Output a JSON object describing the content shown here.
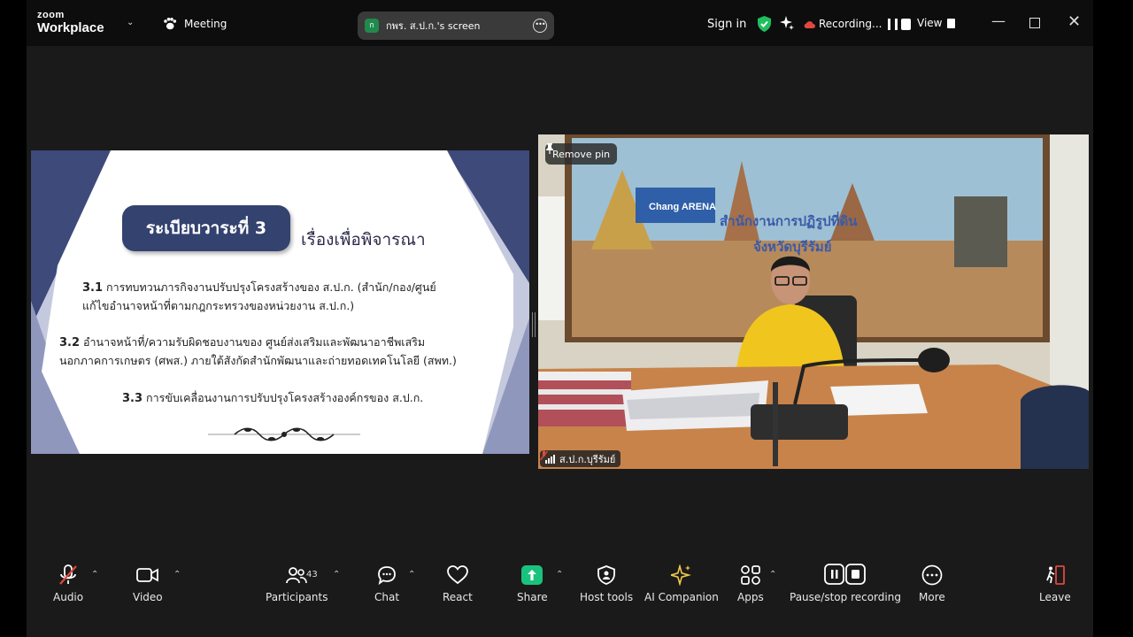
{
  "app": {
    "logo_top": "zoom",
    "logo_bottom": "Workplace",
    "meeting_label": "Meeting",
    "screen_pill": {
      "avatar_letter": "ก",
      "text": "กพร. ส.ป.ก.'s screen"
    },
    "sign_in": "Sign in",
    "recording_label": "Recording...",
    "view_label": "View"
  },
  "colors": {
    "share_green": "#19c37d",
    "shield_green": "#1fbf5f",
    "muted_red": "#e0483e",
    "slide_navy": "#34426f"
  },
  "slide": {
    "agenda_label": "ระเบียบวาระที่ 3",
    "agenda_title": "เรื่องเพื่อพิจารณา",
    "items": [
      {
        "num": "3.1",
        "line1": "การทบทวนภารกิจงานปรับปรุงโครงสร้างของ ส.ป.ก. (สำนัก/กอง/ศูนย์",
        "line2": "แก้ไขอำนาจหน้าที่ตามกฎกระทรวงของหน่วยงาน ส.ป.ก.)"
      },
      {
        "num": "3.2",
        "line1": "อำนาจหน้าที่/ความรับผิดชอบงานของ ศูนย์ส่งเสริมและพัฒนาอาชีพเสริม",
        "line2": "นอกภาคการเกษตร (ศพส.) ภายใต้สังกัดสำนักพัฒนาและถ่ายทอดเทคโนโลยี (สพท.)"
      },
      {
        "num": "3.3",
        "line1": "การขับเคลื่อนงานการปรับปรุงโครงสร้างองค์กรของ ส.ป.ก."
      }
    ]
  },
  "video": {
    "remove_pin": "Remove pin",
    "participant_name": "ส.ป.ก.บุรีรัมย์",
    "banner_line1": "สำนักงานการปฏิรูปที่ดิน",
    "banner_line2": "จังหวัดบุรีรัมย์",
    "sign_text": "Chang ARENA"
  },
  "toolbar": {
    "audio": "Audio",
    "video": "Video",
    "participants": "Participants",
    "participants_count": "43",
    "chat": "Chat",
    "react": "React",
    "share": "Share",
    "host_tools": "Host tools",
    "ai_companion": "AI Companion",
    "apps": "Apps",
    "pause_stop": "Pause/stop recording",
    "more": "More",
    "leave": "Leave"
  }
}
